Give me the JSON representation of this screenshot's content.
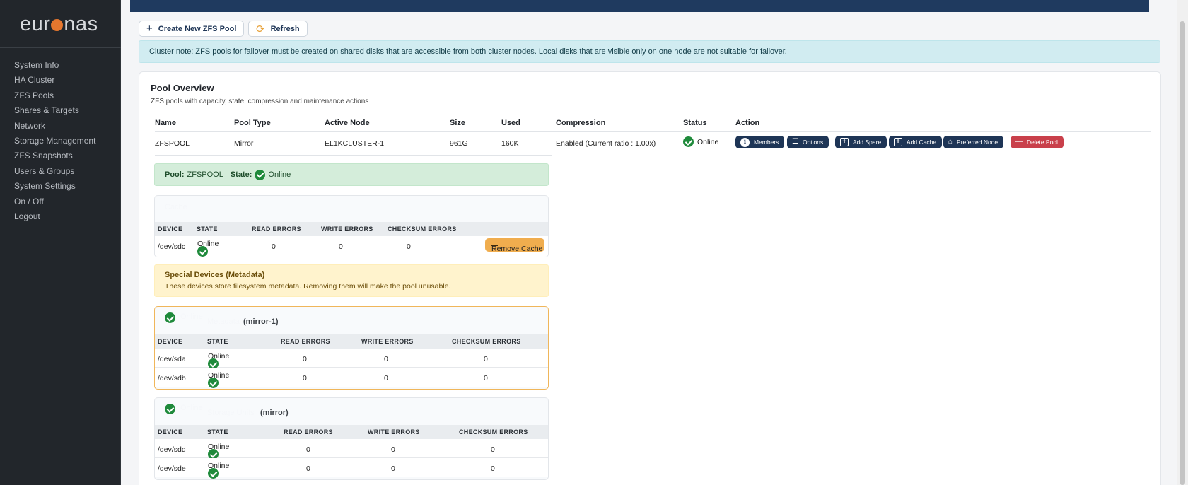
{
  "brand": {
    "logo_left": "eur",
    "logo_right": "nas"
  },
  "sidebar": {
    "items": [
      "System Info",
      "HA Cluster",
      "ZFS Pools",
      "Shares & Targets",
      "Network",
      "Storage Management",
      "ZFS Snapshots",
      "Users & Groups",
      "System Settings",
      "On / Off",
      "Logout"
    ]
  },
  "toolbar": {
    "create_label": "Create New ZFS Pool",
    "refresh_label": "Refresh"
  },
  "cluster_note": "Cluster note: ZFS pools for failover must be created on shared disks that are accessible from both cluster nodes. Local disks that are visible only on one node are not suitable for failover.",
  "overview": {
    "title": "Pool Overview",
    "subtitle": "ZFS pools with capacity, state, compression and maintenance actions",
    "columns": [
      "Name",
      "Pool Type",
      "Active Node",
      "Size",
      "Used",
      "Compression",
      "Status",
      "Action"
    ],
    "row": {
      "name": "ZFSPOOL",
      "type": "Mirror",
      "node": "EL1KCLUSTER-1",
      "size": "961G",
      "used": "160K",
      "compression": "Enabled (Current ratio : 1.00x)",
      "status": "Online"
    },
    "actions": {
      "members": "Members",
      "options": "Options",
      "add_spare": "Add Spare",
      "add_cache": "Add Cache",
      "preferred_node": "Preferred Node",
      "delete_pool": "Delete Pool"
    }
  },
  "pool_state": {
    "pool_label": "Pool:",
    "pool_name": "ZFSPOOL",
    "state_label": "State:",
    "state": "Online"
  },
  "device_columns": [
    "DEVICE",
    "STATE",
    "READ ERRORS",
    "WRITE ERRORS",
    "CHECKSUM ERRORS"
  ],
  "cache": {
    "title": "Cache",
    "rows": [
      {
        "device": "/dev/sdc",
        "state": "Online",
        "read": "0",
        "write": "0",
        "checksum": "0"
      }
    ],
    "remove_label": "Remove Cache"
  },
  "special": {
    "title": "Special Devices (Metadata)",
    "desc": "These devices store filesystem metadata. Removing them will make the pool unusable."
  },
  "group1": {
    "state": "Online",
    "label": "Metadata",
    "vdev": "(mirror-1)",
    "rows": [
      {
        "device": "/dev/sda",
        "state": "Online",
        "read": "0",
        "write": "0",
        "checksum": "0"
      },
      {
        "device": "/dev/sdb",
        "state": "Online",
        "read": "0",
        "write": "0",
        "checksum": "0"
      }
    ]
  },
  "group2": {
    "state": "Online",
    "label": "Storage Units",
    "vdev": "(mirror)",
    "rows": [
      {
        "device": "/dev/sdd",
        "state": "Online",
        "read": "0",
        "write": "0",
        "checksum": "0"
      },
      {
        "device": "/dev/sde",
        "state": "Online",
        "read": "0",
        "write": "0",
        "checksum": "0"
      }
    ]
  }
}
